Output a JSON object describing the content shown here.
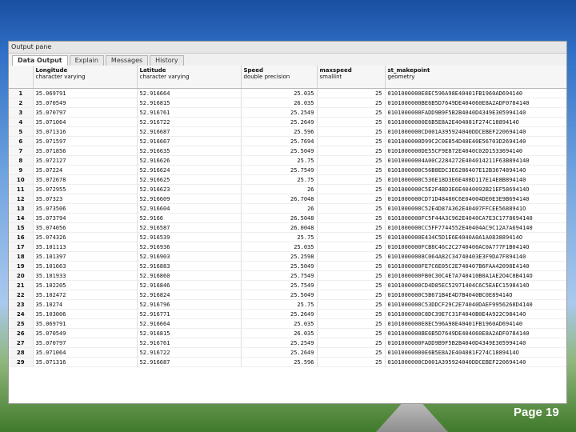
{
  "panel": {
    "title": "Output pane"
  },
  "tabs": [
    "Data Output",
    "Explain",
    "Messages",
    "History"
  ],
  "columns": [
    {
      "name": "Longitude",
      "type": "character varying"
    },
    {
      "name": "Latitude",
      "type": "character varying"
    },
    {
      "name": "Speed",
      "type": "double precision"
    },
    {
      "name": "maxspeed",
      "type": "smallint"
    },
    {
      "name": "st_makepoint",
      "type": "geometry"
    }
  ],
  "rows": [
    [
      "1",
      "35.069791",
      "52.916664",
      "25.035",
      "25",
      "0101000000E8EC596A98E40401FB1960AD694140"
    ],
    [
      "2",
      "35.070549",
      "52.916815",
      "26.035",
      "25",
      "0101000000BE6B5D7649DE404060E8A2ADF0784140"
    ],
    [
      "3",
      "35.070797",
      "52.916761",
      "25.2549",
      "25",
      "0101000000FADD9B9F5B2B4040D4349E305994140"
    ],
    [
      "4",
      "35.071064",
      "52.916722",
      "25.2649",
      "25",
      "01010000000E6B5E8A2E404081F274C1889414O"
    ],
    [
      "5",
      "35.071316",
      "52.916687",
      "25.596",
      "25",
      "0101000000CD001A395924040DDCEBEF220694140"
    ],
    [
      "6",
      "35.071597",
      "52.916667",
      "25.7694",
      "25",
      "0101000000D99C2C0E854D40E40E56703D2694140"
    ],
    [
      "7",
      "35.071856",
      "52.916635",
      "25.5049",
      "25",
      "0101000000DE55CF9E872E4040C02D1533694140"
    ],
    [
      "8",
      "35.072127",
      "52.916626",
      "25.75",
      "25",
      "01010000004A00C2284272E404014211F63B894140"
    ],
    [
      "9",
      "35.07224",
      "52.916624",
      "25.7549",
      "25",
      "0101000000C56B8EDC3E6286407E12B367489414O"
    ],
    [
      "10",
      "35.072678",
      "52.916625",
      "25.75",
      "25",
      "0101000000C536E18D3E6E408D117E14E8B894140"
    ],
    [
      "11",
      "35.072955",
      "52.916623",
      "26",
      "25",
      "0101000000C5E2F4BD3E6E4040092B21EF5869414O"
    ],
    [
      "12",
      "35.07323",
      "52.916609",
      "26.7048",
      "25",
      "0101000000CD71D48480C6E04004DE0E3E9B694140"
    ],
    [
      "13",
      "35.073506",
      "52.916604",
      "26",
      "25",
      "0101000000C52E4D87A362E40407FFCEE5688941O"
    ],
    [
      "14",
      "35.073794",
      "52.9166",
      "26.5048",
      "25",
      "0101000000FC5F44A3C962E4040CA7E3C1778694140"
    ],
    [
      "15",
      "35.074056",
      "52.916587",
      "26.0048",
      "25",
      "0101000000CC5FF7744552E40404AC9C12A7A694140"
    ],
    [
      "16",
      "35.074326",
      "52.916539",
      "25.75",
      "25",
      "0101000000E434C5D1E6E4040A0A1A083889414O"
    ],
    [
      "17",
      "35.101113",
      "52.916936",
      "25.035",
      "25",
      "0101000000FCB8C46C2C2740400AC0A777F1B0414O"
    ],
    [
      "18",
      "35.101397",
      "52.916903",
      "25.2598",
      "25",
      "01010000008C064A82C34740403E3F9DA7F894140"
    ],
    [
      "19",
      "35.101663",
      "52.916883",
      "25.5049",
      "25",
      "0101000000FE7C6E05C2E740407B6FAA42098E4140"
    ],
    [
      "20",
      "35.101933",
      "52.916860",
      "25.7549",
      "25",
      "0101000000FB0C30C4E7A740410B0A1AE2O4C8B414O"
    ],
    [
      "21",
      "35.102205",
      "52.916846",
      "25.7549",
      "25",
      "0101000000CD4D85EC52971404C6C5EAEC1598414O"
    ],
    [
      "22",
      "35.102472",
      "52.916824",
      "25.5049",
      "25",
      "0101000000C5B671B4E4D7B4040BC0E89414O"
    ],
    [
      "23",
      "35.10274",
      "52.916796",
      "25.75",
      "25",
      "0101000000C53DDCF29C2E74040DAEF9956268D4140"
    ],
    [
      "24",
      "35.103006",
      "52.916771",
      "25.2649",
      "25",
      "0101000000C8DC39E7C31F4040B0E4A922C98414O"
    ],
    [
      "25",
      "35.069791",
      "52.916664",
      "25.035",
      "25",
      "0101000000E8EC596A98E40401FB1960AD694140"
    ],
    [
      "26",
      "35.070549",
      "52.916815",
      "26.035",
      "25",
      "0101000000BE6B5D7649DE404060E8A2ADF0784140"
    ],
    [
      "27",
      "35.070797",
      "52.916761",
      "25.2549",
      "25",
      "0101000000FADD9B9F5B2B4040D4349E305994140"
    ],
    [
      "28",
      "35.071064",
      "52.916722",
      "25.2649",
      "25",
      "01010000000E6B5E8A2E404081F274C1889414O"
    ],
    [
      "29",
      "35.071316",
      "52.916687",
      "25.596",
      "25",
      "0101000000CD001A395924040DDCEBEF220694140"
    ]
  ],
  "footer": {
    "page_label": "Page 19"
  }
}
